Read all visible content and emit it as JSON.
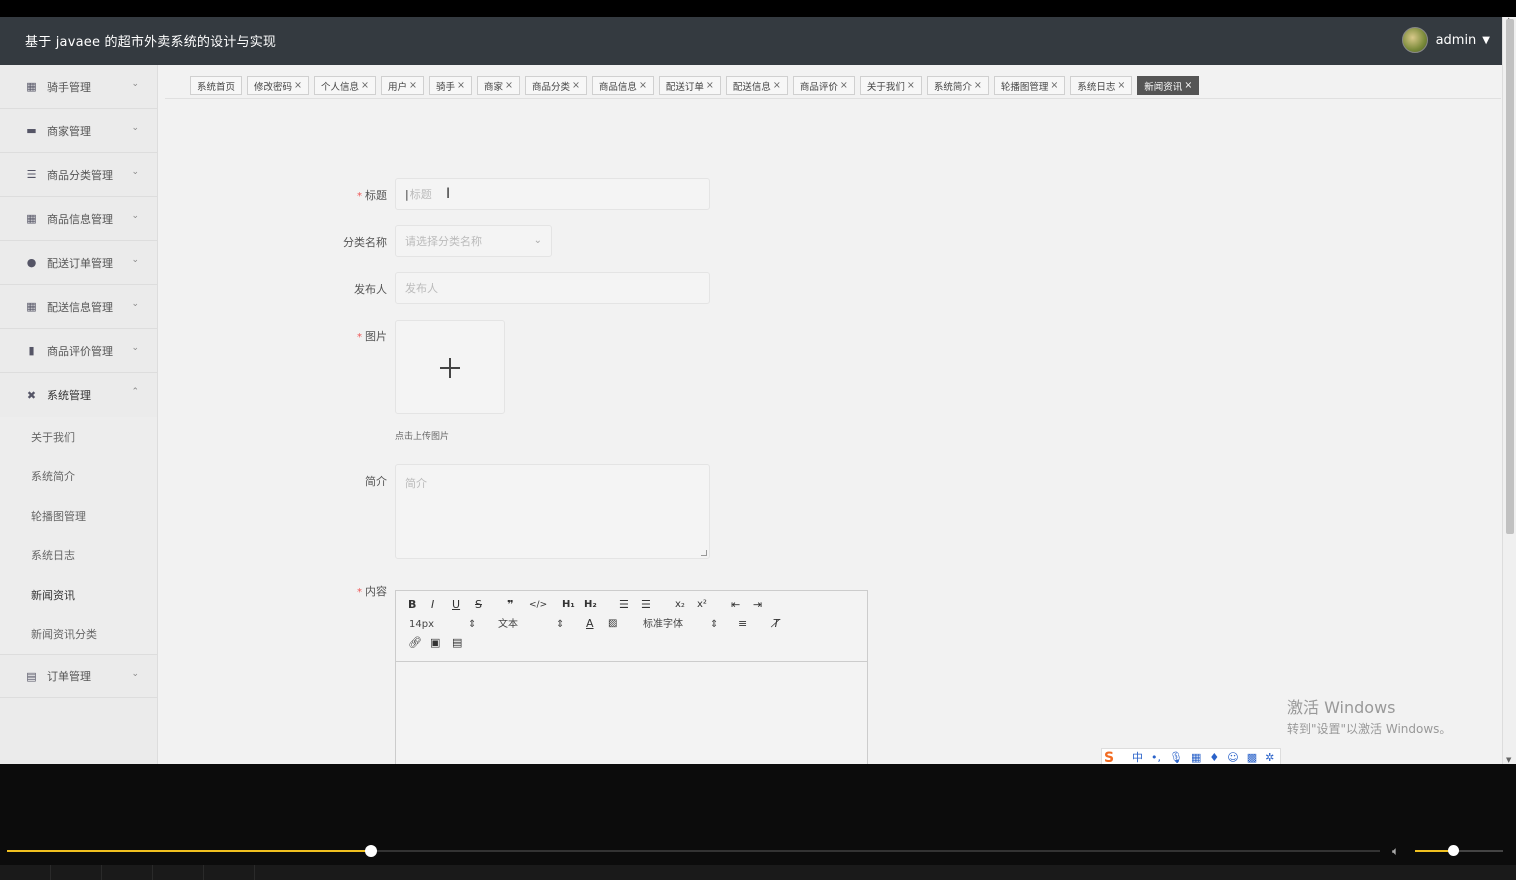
{
  "header": {
    "title": "基于 javaee 的超市外卖系统的设计与实现",
    "user": "admin"
  },
  "sidebar": {
    "items": [
      {
        "label": "骑手管理"
      },
      {
        "label": "商家管理"
      },
      {
        "label": "商品分类管理"
      },
      {
        "label": "商品信息管理"
      },
      {
        "label": "配送订单管理"
      },
      {
        "label": "配送信息管理"
      },
      {
        "label": "商品评价管理"
      },
      {
        "label": "系统管理"
      },
      {
        "label": "订单管理"
      }
    ],
    "system_submenu": [
      "关于我们",
      "系统简介",
      "轮播图管理",
      "系统日志",
      "新闻资讯",
      "新闻资讯分类"
    ]
  },
  "tabs": [
    "系统首页",
    "修改密码",
    "个人信息",
    "用户",
    "骑手",
    "商家",
    "商品分类",
    "商品信息",
    "配送订单",
    "配送信息",
    "商品评价",
    "关于我们",
    "系统简介",
    "轮播图管理",
    "系统日志",
    "新闻资讯"
  ],
  "tab_close": "×",
  "form": {
    "title_label": "标题",
    "title_placeholder": "标题",
    "category_label": "分类名称",
    "category_placeholder": "请选择分类名称",
    "publisher_label": "发布人",
    "publisher_placeholder": "发布人",
    "image_label": "图片",
    "upload_hint": "点击上传图片",
    "summary_label": "简介",
    "summary_placeholder": "简介",
    "content_label": "内容",
    "required_mark": "*"
  },
  "editor": {
    "font_size": "14px",
    "text_style": "文本",
    "font_family": "标准字体"
  },
  "watermark": {
    "line1": "激活 Windows",
    "line2": "转到\"设置\"以激活 Windows。"
  },
  "ime": {
    "logo": "S",
    "lang": "中"
  },
  "player": {
    "progress": 0.265,
    "volume": 0.43
  }
}
